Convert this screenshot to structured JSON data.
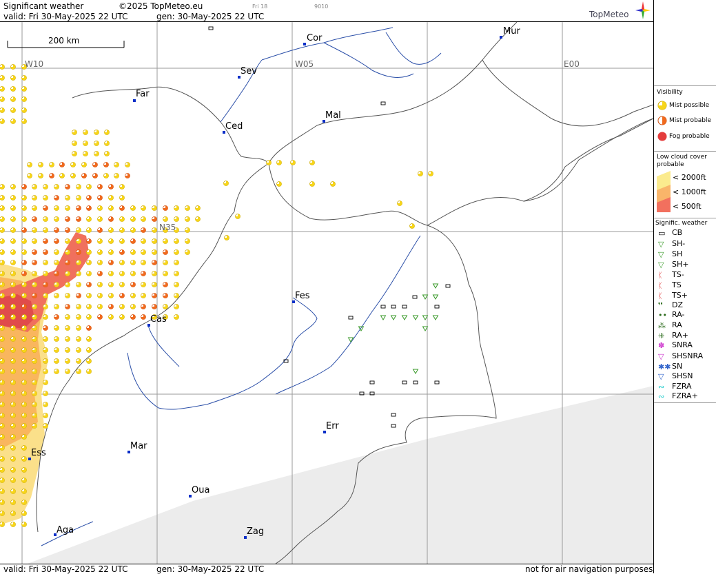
{
  "header": {
    "title": "Significant weather",
    "copyright": "©2025 TopMeteo.eu",
    "day": "Fri 18",
    "code": "9010",
    "valid": "valid:  Fri  30-May-2025  22 UTC",
    "gen": "gen: 30-May-2025 22 UTC",
    "logo": "TopMeteo"
  },
  "footer": {
    "valid": "valid:  Fri  30-May-2025  22 UTC",
    "gen": "gen: 30-May-2025 22 UTC",
    "disclaimer": "not for air navigation purposes"
  },
  "map": {
    "scale_label": "200 km",
    "grid_labels": {
      "w10": "W10",
      "w05": "W05",
      "e00": "E00",
      "n35": "N35"
    },
    "cities": {
      "cor": "Cor",
      "mur": "Mur",
      "sev": "Sev",
      "far": "Far",
      "ced": "Ced",
      "mal": "Mal",
      "fes": "Fes",
      "cas": "Cas",
      "err": "Err",
      "mar": "Mar",
      "ess": "Ess",
      "oua": "Oua",
      "aga": "Aga",
      "zag": "Zag"
    },
    "colors": {
      "mist_possible": "#f7d51a",
      "mist_probable": "#f06a1e",
      "fog_probable": "#e43c3c",
      "cloud_2000": "#fbeb8e",
      "cloud_1000": "#f9b56a",
      "cloud_500": "#f2705e",
      "shower": "#3a9a2a"
    }
  },
  "legend": {
    "visibility_title": "Visibility",
    "visibility": {
      "mist_possible": "Mist possible",
      "mist_probable": "Mist probable",
      "fog_probable": "Fog probable"
    },
    "cloud_title_1": "Low cloud cover",
    "cloud_title_2": "probable",
    "cloud": {
      "c2000": "< 2000ft",
      "c1000": "< 1000ft",
      "c500": "<   500ft"
    },
    "sig_title": "Signific. weather",
    "sig": {
      "cb": "CB",
      "sh_minus": "SH-",
      "sh": "SH",
      "sh_plus": "SH+",
      "ts_minus": "TS-",
      "ts": "TS",
      "ts_plus": "TS+",
      "dz": "DZ",
      "ra_minus": "RA-",
      "ra": "RA",
      "ra_plus": "RA+",
      "snra": "SNRA",
      "shsnra": "SHSNRA",
      "sn": "SN",
      "shsn": "SHSN",
      "fzra": "FZRA",
      "fzra_plus": "FZRA+"
    }
  }
}
